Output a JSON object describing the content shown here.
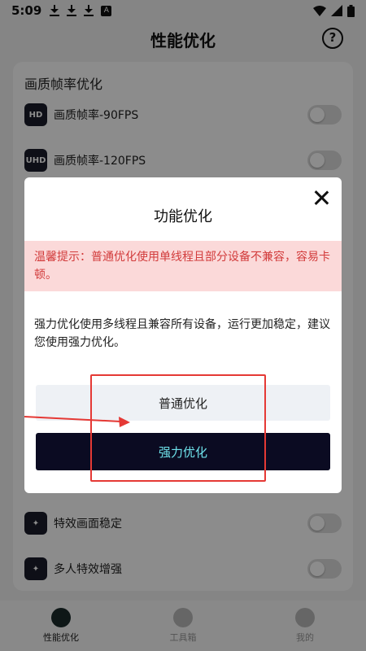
{
  "status": {
    "time": "5:09"
  },
  "header": {
    "title": "性能优化",
    "help_glyph": "?"
  },
  "section": {
    "title": "画质帧率优化",
    "rows": [
      {
        "badge": "HD",
        "label": "画质帧率-90FPS"
      },
      {
        "badge": "UHD",
        "label": "画质帧率-120FPS"
      },
      {
        "badge": "✦",
        "label": "特效画面稳定"
      },
      {
        "badge": "✦",
        "label": "多人特效增强"
      }
    ]
  },
  "dialog": {
    "title": "功能优化",
    "warning": "温馨提示：普通优化使用单线程且部分设备不兼容，容易卡顿。",
    "description": "强力优化使用多线程且兼容所有设备，运行更加稳定，建议您使用强力优化。",
    "normal_button": "普通优化",
    "strong_button": "强力优化"
  },
  "nav": {
    "items": [
      {
        "label": "性能优化",
        "active": true
      },
      {
        "label": "工具箱",
        "active": false
      },
      {
        "label": "我的",
        "active": false
      }
    ]
  },
  "colors": {
    "accent": "#6fe3ec",
    "dark_button": "#0b0b22",
    "warning_bg": "#fbd9d9",
    "warning_text": "#d23b3b",
    "annotation": "#e53935"
  }
}
